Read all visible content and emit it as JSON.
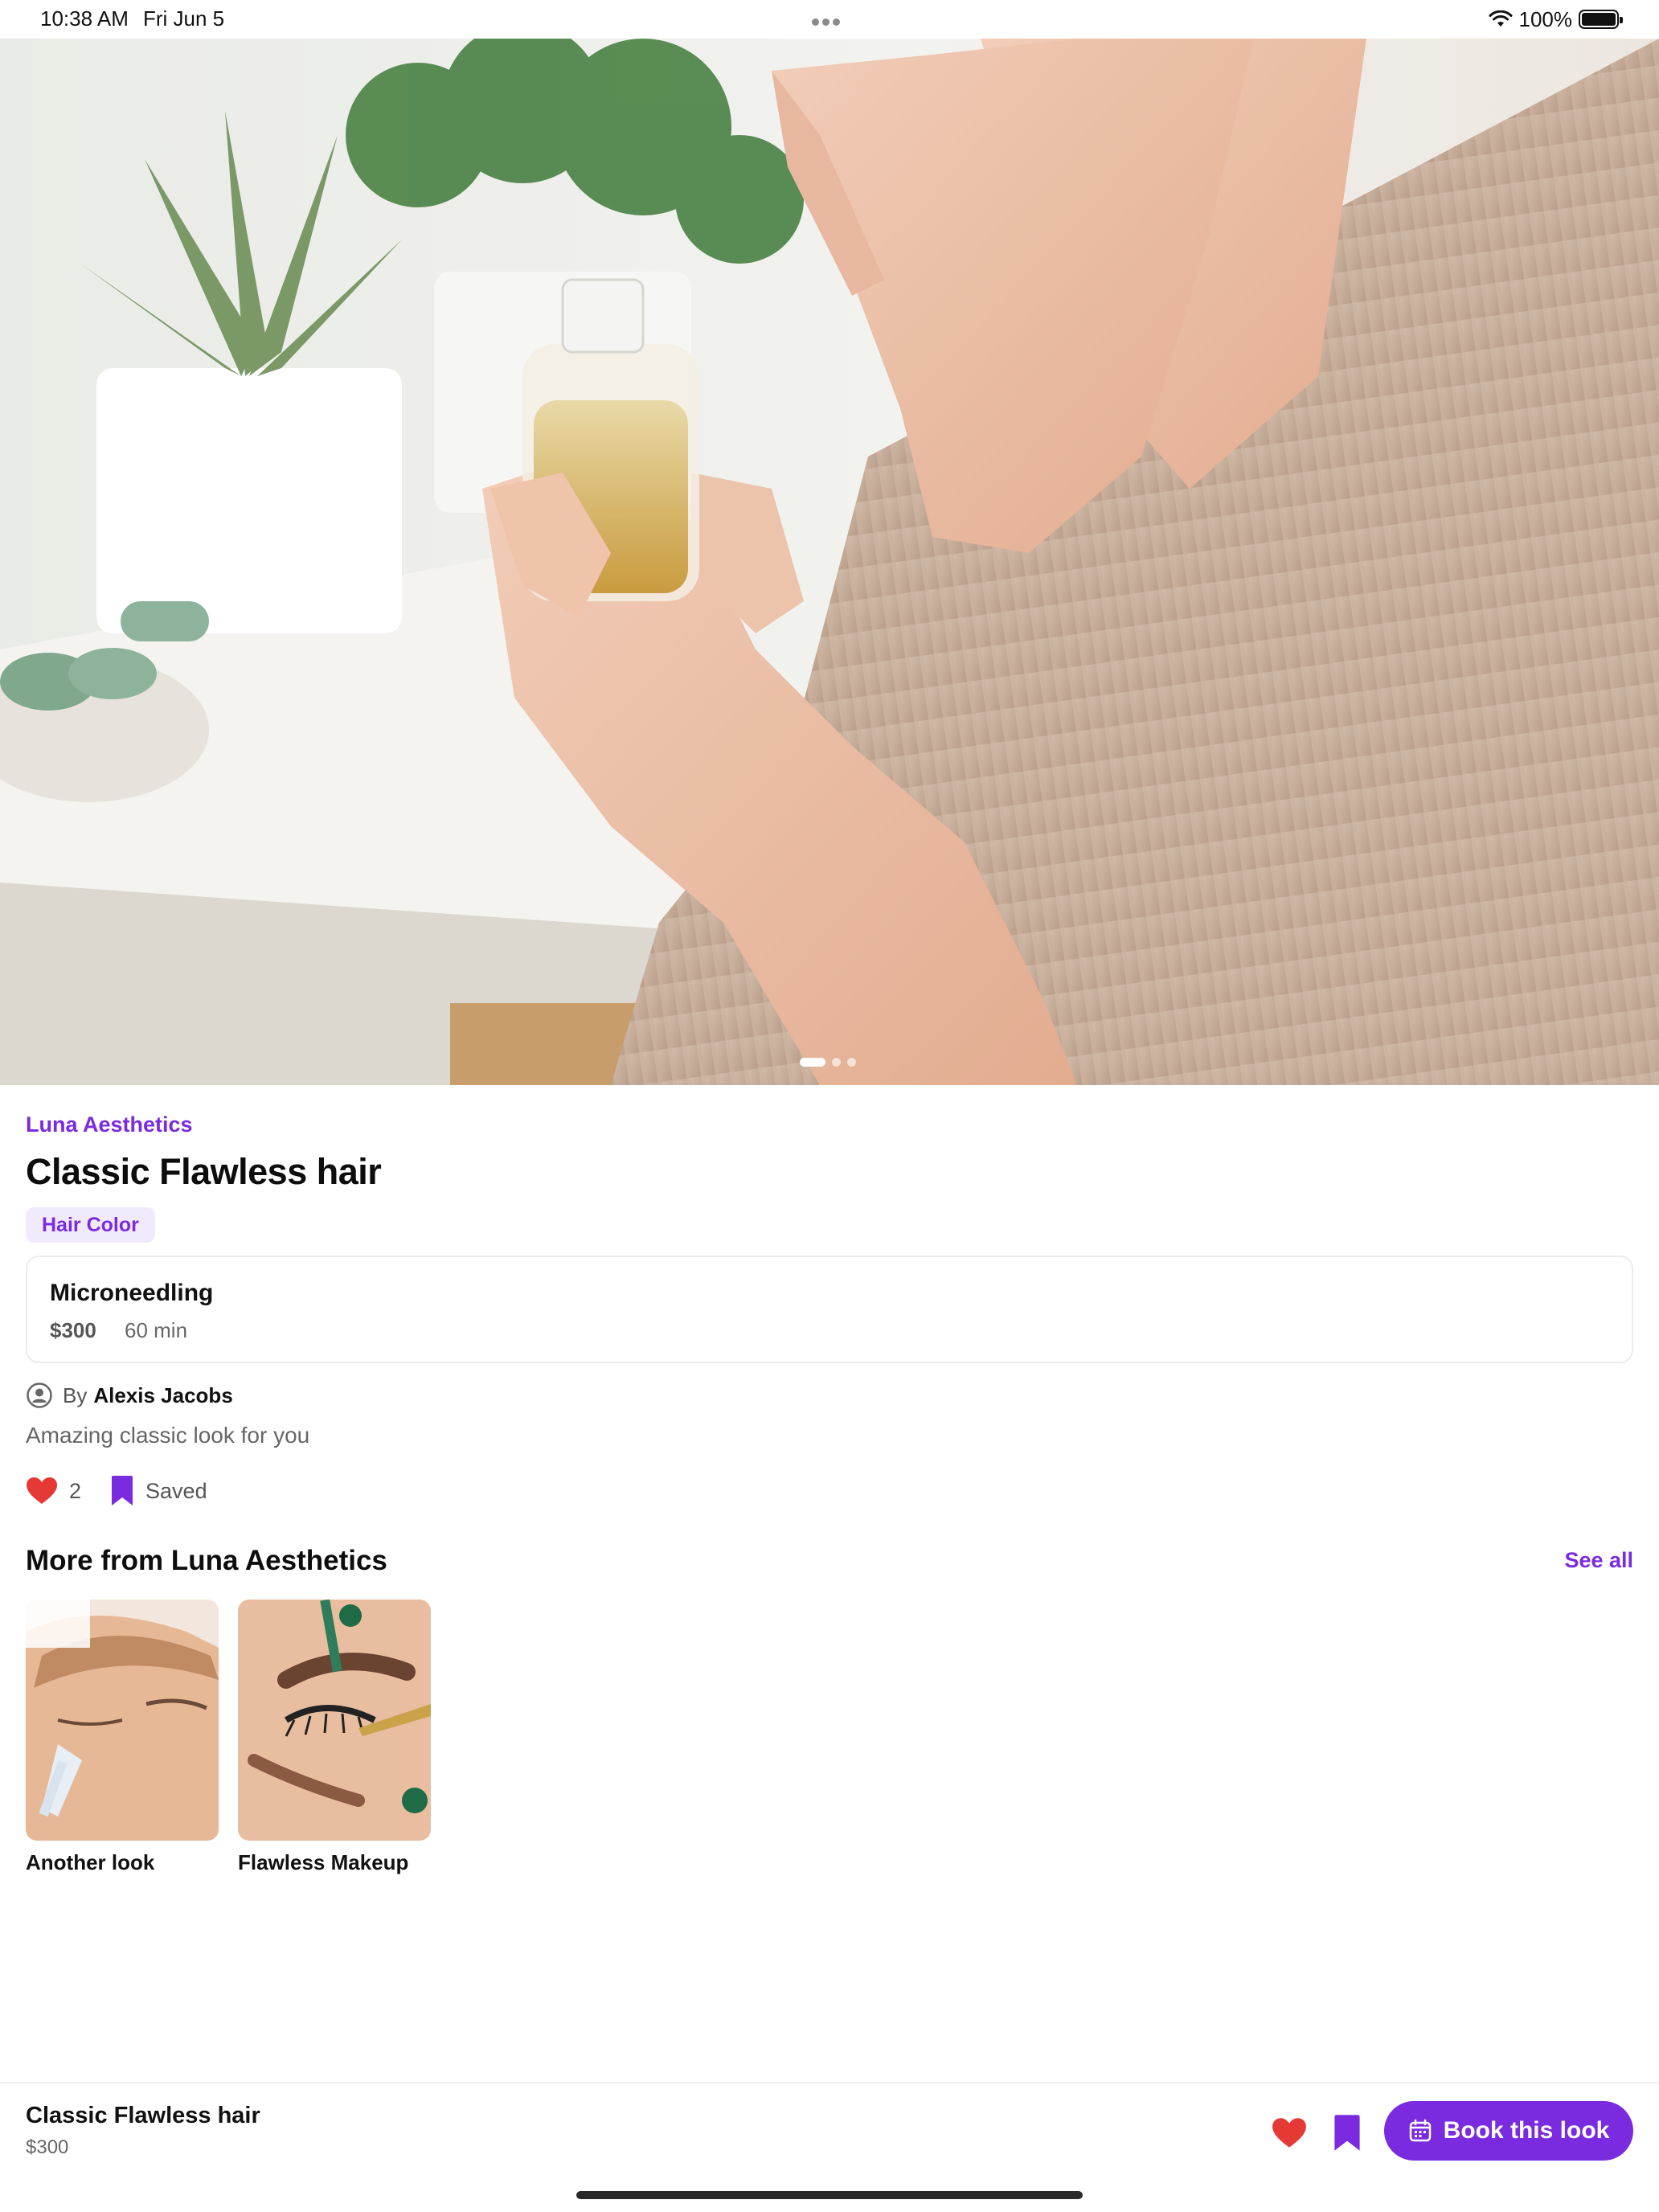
{
  "status_bar": {
    "time": "10:38 AM",
    "date": "Fri Jun 5",
    "battery": "100%",
    "icons": [
      "wifi-icon",
      "battery-icon"
    ]
  },
  "hero": {
    "image_description_icon": "hero-photo",
    "page_count": 3,
    "active_page": 1
  },
  "look": {
    "salon": "Luna Aesthetics",
    "title": "Classic Flawless hair",
    "category": "Hair Color",
    "description": "Amazing classic look for you"
  },
  "service": {
    "name": "Microneedling",
    "price": "$300",
    "duration": "60 min"
  },
  "author": {
    "by_label": "By",
    "name": "Alexis Jacobs"
  },
  "engagement": {
    "likes": "2",
    "saved_label": "Saved"
  },
  "more": {
    "title": "More from Luna Aesthetics",
    "see_all": "See all",
    "items": [
      {
        "label": "Another look"
      },
      {
        "label": "Flawless Makeup"
      }
    ]
  },
  "bottom_bar": {
    "title": "Classic Flawless hair",
    "price": "$300",
    "book_label": "Book this look"
  },
  "colors": {
    "accent": "#7a2be0",
    "heart": "#e53935",
    "tag_bg": "#f1eafd"
  }
}
